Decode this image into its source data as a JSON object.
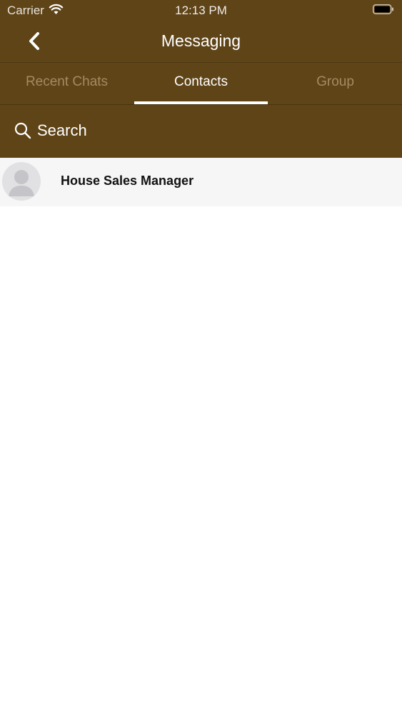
{
  "status_bar": {
    "carrier": "Carrier",
    "time": "12:13 PM"
  },
  "nav": {
    "title": "Messaging",
    "back_icon": "chevron-left-icon"
  },
  "tabs": [
    {
      "label": "Recent Chats",
      "active": false
    },
    {
      "label": "Contacts",
      "active": true
    },
    {
      "label": "Group",
      "active": false
    }
  ],
  "search": {
    "placeholder": "Search",
    "icon": "search-icon"
  },
  "contacts": [
    {
      "name": "House Sales Manager",
      "avatar": "default-avatar-icon"
    }
  ],
  "colors": {
    "header_bg": "#5f4418",
    "tab_inactive": "#a48a62",
    "tab_active": "#ffffff",
    "row_bg": "#f6f6f7"
  }
}
